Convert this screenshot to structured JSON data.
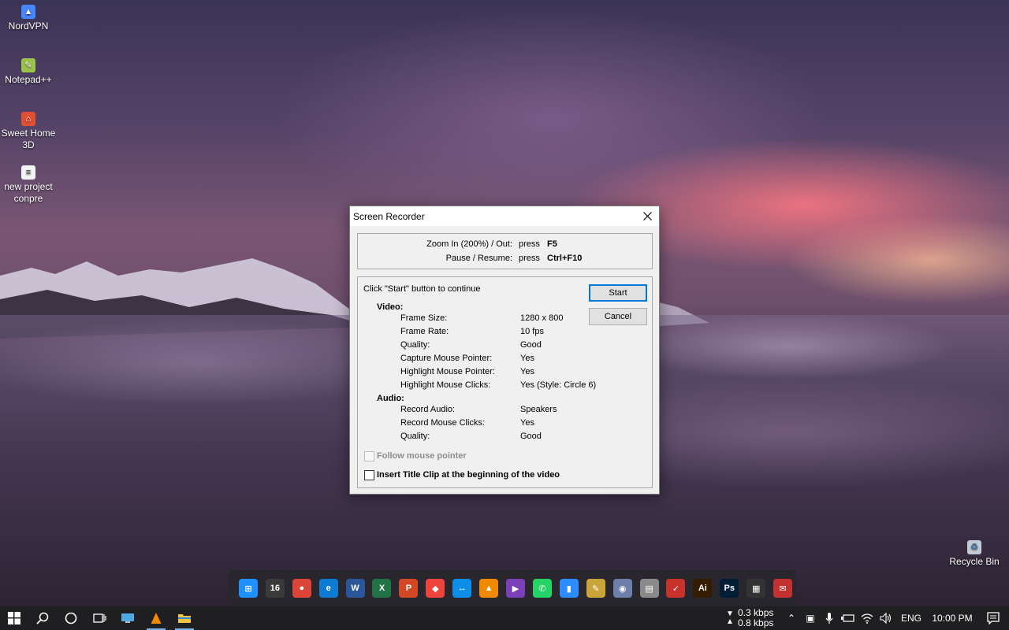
{
  "desktop": {
    "icons": [
      {
        "label": "NordVPN"
      },
      {
        "label": "Notepad++"
      },
      {
        "label": "Sweet Home 3D"
      },
      {
        "label": "new project conpre"
      },
      {
        "label": "Recycle Bin"
      }
    ]
  },
  "dialog": {
    "title": "Screen Recorder",
    "hotkeys": [
      {
        "label": "Zoom In (200%) / Out:",
        "press": "press",
        "key": "F5"
      },
      {
        "label": "Pause / Resume:",
        "press": "press",
        "key": "Ctrl+F10"
      }
    ],
    "instruction": "Click \"Start\" button to continue",
    "start_label": "Start",
    "cancel_label": "Cancel",
    "video": {
      "heading": "Video:",
      "rows": [
        {
          "label": "Frame Size:",
          "value": "1280 x 800"
        },
        {
          "label": "Frame Rate:",
          "value": "10 fps"
        },
        {
          "label": "Quality:",
          "value": "Good"
        },
        {
          "label": "Capture Mouse Pointer:",
          "value": "Yes"
        },
        {
          "label": "Highlight Mouse Pointer:",
          "value": "Yes"
        },
        {
          "label": "Highlight Mouse Clicks:",
          "value": "Yes (Style: Circle 6)"
        }
      ]
    },
    "audio": {
      "heading": "Audio:",
      "rows": [
        {
          "label": "Record Audio:",
          "value": "Speakers"
        },
        {
          "label": "Record Mouse Clicks:",
          "value": "Yes"
        },
        {
          "label": "Quality:",
          "value": "Good"
        }
      ]
    },
    "follow_pointer_label": "Follow mouse pointer",
    "title_clip_label": "Insert Title Clip at the beginning of the video"
  },
  "dock": {
    "apps": [
      {
        "name": "windows",
        "glyph": "⊞",
        "color": "#1e90ff"
      },
      {
        "name": "calendar",
        "glyph": "16",
        "color": "#3a3a3a"
      },
      {
        "name": "chrome",
        "glyph": "●",
        "color": "#db4437"
      },
      {
        "name": "edge",
        "glyph": "e",
        "color": "#0c7bd4"
      },
      {
        "name": "word",
        "glyph": "W",
        "color": "#2b579a"
      },
      {
        "name": "excel",
        "glyph": "X",
        "color": "#217346"
      },
      {
        "name": "powerpoint",
        "glyph": "P",
        "color": "#d24726"
      },
      {
        "name": "anydesk",
        "glyph": "◆",
        "color": "#ef443b"
      },
      {
        "name": "teamviewer",
        "glyph": "↔",
        "color": "#0e8ee9"
      },
      {
        "name": "vlc",
        "glyph": "▲",
        "color": "#f08a00"
      },
      {
        "name": "visual-studio",
        "glyph": "▶",
        "color": "#7b3fb8"
      },
      {
        "name": "whatsapp",
        "glyph": "✆",
        "color": "#25d366"
      },
      {
        "name": "zoom",
        "glyph": "▮",
        "color": "#2d8cff"
      },
      {
        "name": "pen-tool",
        "glyph": "✎",
        "color": "#c9a43a"
      },
      {
        "name": "car-app",
        "glyph": "◉",
        "color": "#6b7fa8"
      },
      {
        "name": "disk-app",
        "glyph": "▤",
        "color": "#8a8a8a"
      },
      {
        "name": "maps-app",
        "glyph": "✓",
        "color": "#c8322b"
      },
      {
        "name": "illustrator",
        "glyph": "Ai",
        "color": "#331c00"
      },
      {
        "name": "photoshop",
        "glyph": "Ps",
        "color": "#001e36"
      },
      {
        "name": "matrix-app",
        "glyph": "▦",
        "color": "#333333"
      },
      {
        "name": "mail-app",
        "glyph": "✉",
        "color": "#c43131"
      }
    ]
  },
  "taskbar": {
    "net_down": "0.3 kbps",
    "net_up": "0.8 kbps",
    "language": "ENG",
    "time": "10:00 PM"
  },
  "colors": {
    "accent": "#0078d7",
    "taskbar": "#1f1f22"
  }
}
